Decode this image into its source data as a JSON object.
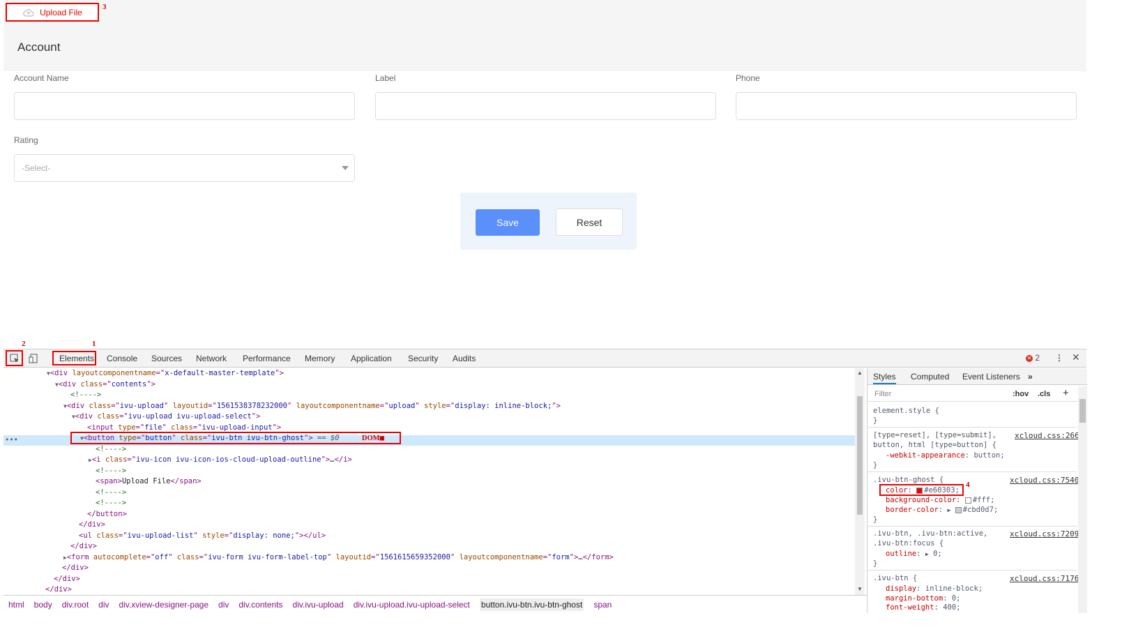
{
  "app": {
    "upload_label": "Upload File",
    "page_title": "Account",
    "fields": {
      "account_name_label": "Account Name",
      "label_label": "Label",
      "phone_label": "Phone",
      "rating_label": "Rating",
      "rating_placeholder": "-Select-"
    },
    "buttons": {
      "save": "Save",
      "reset": "Reset"
    }
  },
  "annotations": {
    "n1": "1",
    "n2": "2",
    "n3": "3",
    "n4": "4",
    "dom_note": "DOM"
  },
  "devtools": {
    "tabs": [
      "Elements",
      "Console",
      "Sources",
      "Network",
      "Performance",
      "Memory",
      "Application",
      "Security",
      "Audits"
    ],
    "error_count": "2",
    "breadcrumbs": [
      "html",
      "body",
      "div.root",
      "div",
      "div.xview-designer-page",
      "div",
      "div.contents",
      "div.ivu-upload",
      "div.ivu-upload.ivu-upload-select",
      "button.ivu-btn.ivu-btn-ghost",
      "span"
    ],
    "styles_tabs": [
      "Styles",
      "Computed",
      "Event Listeners"
    ],
    "filter_placeholder": "Filter",
    "hov": ":hov",
    "cls": ".cls",
    "dom": {
      "l1": [
        "div",
        "layoutcomponentname",
        "x-default-master-template"
      ],
      "l2": [
        "div",
        "class",
        "contents"
      ],
      "l3": "<!---->",
      "l4_a": [
        "div",
        "class",
        "ivu-upload",
        "layoutid",
        "1561538378232000",
        "layoutcomponentname",
        "upload",
        "style",
        "display: inline-block;"
      ],
      "l5": [
        "div",
        "class",
        "ivu-upload ivu-upload-select"
      ],
      "l6": [
        "input",
        "type",
        "file",
        "class",
        "ivu-upload-input"
      ],
      "l7": [
        "button",
        "type",
        "button",
        "class",
        "ivu-btn ivu-btn-ghost",
        "== $0"
      ],
      "l8": "<!---->",
      "l9": [
        "i",
        "class",
        "ivu-icon ivu-icon-ios-cloud-upload-outline",
        "…"
      ],
      "l10": "<!---->",
      "l11_text": "Upload File",
      "l12": "<!---->",
      "l13": "<!---->",
      "l14": "</button>",
      "l15": "</div>",
      "l16": [
        "ul",
        "class",
        "ivu-upload-list",
        "style",
        "display: none;"
      ],
      "l17": "</div>",
      "l18": [
        "form",
        "autocomplete",
        "off",
        "class",
        "ivu-form ivu-form-label-top",
        "layoutid",
        "1561615659352000",
        "layoutcomponentname",
        "form",
        "…"
      ],
      "l19": "</div>",
      "l20": "</div>",
      "l21": "</div>"
    },
    "styles": {
      "element_style": "element.style {",
      "r2_sel1": "[type=reset], [type=submit],",
      "r2_sel2": "button, html [type=button] {",
      "r2_src": "xcloud.css:266",
      "r2_prop": "-webkit-appearance",
      "r2_val": "button;",
      "r3_sel": ".ivu-btn-ghost {",
      "r3_src": "xcloud.css:7540",
      "r3_p1": "color",
      "r3_v1": "#e60303;",
      "r3_p2": "background-color",
      "r3_v2": "#fff;",
      "r3_p3": "border-color",
      "r3_v3": "#cbd0d7;",
      "r4_sel1": ".ivu-btn, .ivu-btn:active,",
      "r4_sel2": ".ivu-btn:focus {",
      "r4_src": "xcloud.css:7209",
      "r4_prop": "outline",
      "r4_val": "0;",
      "r5_sel": ".ivu-btn {",
      "r5_src": "xcloud.css:7176",
      "r5_p1": "display",
      "r5_v1": "inline-block;",
      "r5_p2": "margin-bottom",
      "r5_v2": "0;",
      "r5_p3": "font-weight",
      "r5_v3": "400;",
      "close_brace": "}"
    }
  },
  "colors": {
    "ghost_color": "#e60303",
    "swatch_bg": "#ffffff",
    "swatch_border": "#cbd0d7",
    "save_bg": "#5b8ff9"
  }
}
